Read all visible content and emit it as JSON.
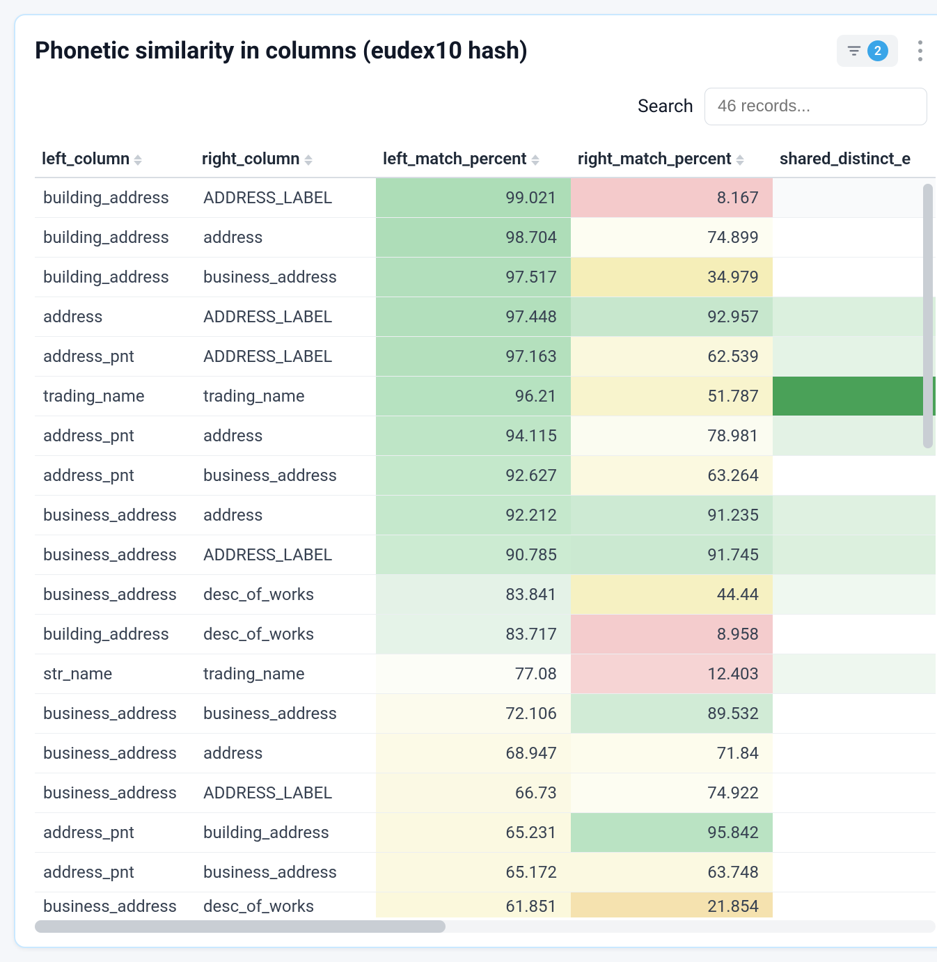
{
  "header": {
    "title": "Phonetic similarity in columns (eudex10 hash)",
    "filter_badge": "2"
  },
  "search": {
    "label": "Search",
    "placeholder": "46 records..."
  },
  "columns": {
    "left_column": "left_column",
    "right_column": "right_column",
    "left_match_percent": "left_match_percent",
    "right_match_percent": "right_match_percent",
    "shared_distinct": "shared_distinct_e"
  },
  "chart_data": {
    "type": "table",
    "title": "Phonetic similarity in columns (eudex10 hash)",
    "columns": [
      "left_column",
      "right_column",
      "left_match_percent",
      "right_match_percent"
    ],
    "rows": [
      {
        "left_column": "building_address",
        "right_column": "ADDRESS_LABEL",
        "left_match_percent": 99.021,
        "right_match_percent": 8.167,
        "lmp_color": "#adddb7",
        "rmp_color": "#f4cacb",
        "sd_color": "#f9fafb"
      },
      {
        "left_column": "building_address",
        "right_column": "address",
        "left_match_percent": 98.704,
        "right_match_percent": 74.899,
        "lmp_color": "#aeddb8",
        "rmp_color": "#fdfdf2",
        "sd_color": "#ffffff"
      },
      {
        "left_column": "building_address",
        "right_column": "business_address",
        "left_match_percent": 97.517,
        "right_match_percent": 34.979,
        "lmp_color": "#b2dfbc",
        "rmp_color": "#f5eeb8",
        "sd_color": "#ffffff"
      },
      {
        "left_column": "address",
        "right_column": "ADDRESS_LABEL",
        "left_match_percent": 97.448,
        "right_match_percent": 92.957,
        "lmp_color": "#b2dfbc",
        "rmp_color": "#c7e7cd",
        "sd_color": "#dbf0de"
      },
      {
        "left_column": "address_pnt",
        "right_column": "ADDRESS_LABEL",
        "left_match_percent": 97.163,
        "right_match_percent": 62.539,
        "lmp_color": "#b4e0bd",
        "rmp_color": "#faf8dd",
        "sd_color": "#e4f3e6"
      },
      {
        "left_column": "trading_name",
        "right_column": "trading_name",
        "left_match_percent": 96.21,
        "right_match_percent": 51.787,
        "lmp_color": "#b6e2c0",
        "rmp_color": "#f8f4cd",
        "sd_color": "#4aa158"
      },
      {
        "left_column": "address_pnt",
        "right_column": "address",
        "left_match_percent": 94.115,
        "right_match_percent": 78.981,
        "lmp_color": "#bee5c6",
        "rmp_color": "#fbfcf1",
        "sd_color": "#e3f2e5"
      },
      {
        "left_column": "address_pnt",
        "right_column": "business_address",
        "left_match_percent": 92.627,
        "right_match_percent": 63.264,
        "lmp_color": "#c4e8cb",
        "rmp_color": "#fbf9e0",
        "sd_color": "#ffffff"
      },
      {
        "left_column": "business_address",
        "right_column": "address",
        "left_match_percent": 92.212,
        "right_match_percent": 91.235,
        "lmp_color": "#c5e8cc",
        "rmp_color": "#cdead3",
        "sd_color": "#dff1e1"
      },
      {
        "left_column": "business_address",
        "right_column": "ADDRESS_LABEL",
        "left_match_percent": 90.785,
        "right_match_percent": 91.745,
        "lmp_color": "#ccebd2",
        "rmp_color": "#cbe9d1",
        "sd_color": "#dcf0de"
      },
      {
        "left_column": "business_address",
        "right_column": "desc_of_works",
        "left_match_percent": 83.841,
        "right_match_percent": 44.44,
        "lmp_color": "#e4f2e7",
        "rmp_color": "#f6f1c2",
        "sd_color": "#eff8f0"
      },
      {
        "left_column": "building_address",
        "right_column": "desc_of_works",
        "left_match_percent": 83.717,
        "right_match_percent": 8.958,
        "lmp_color": "#e5f3e8",
        "rmp_color": "#f4cccd",
        "sd_color": "#ffffff"
      },
      {
        "left_column": "str_name",
        "right_column": "trading_name",
        "left_match_percent": 77.08,
        "right_match_percent": 12.403,
        "lmp_color": "#fcfdf7",
        "rmp_color": "#f6d4d4",
        "sd_color": "#eef7ef"
      },
      {
        "left_column": "business_address",
        "right_column": "business_address",
        "left_match_percent": 72.106,
        "right_match_percent": 89.532,
        "lmp_color": "#fcfbed",
        "rmp_color": "#d1ebd6",
        "sd_color": "#ffffff"
      },
      {
        "left_column": "business_address",
        "right_column": "address",
        "left_match_percent": 68.947,
        "right_match_percent": 71.84,
        "lmp_color": "#fcfae7",
        "rmp_color": "#fdfced",
        "sd_color": "#ffffff"
      },
      {
        "left_column": "business_address",
        "right_column": "ADDRESS_LABEL",
        "left_match_percent": 66.73,
        "right_match_percent": 74.922,
        "lmp_color": "#fbf9e4",
        "rmp_color": "#fdfdf2",
        "sd_color": "#ffffff"
      },
      {
        "left_column": "address_pnt",
        "right_column": "building_address",
        "left_match_percent": 65.231,
        "right_match_percent": 95.842,
        "lmp_color": "#fbf9e1",
        "rmp_color": "#bae3c3",
        "sd_color": "#ffffff"
      },
      {
        "left_column": "address_pnt",
        "right_column": "business_address",
        "left_match_percent": 65.172,
        "right_match_percent": 63.748,
        "lmp_color": "#fbf9e1",
        "rmp_color": "#fbf9e1",
        "sd_color": "#ffffff"
      },
      {
        "left_column": "business_address",
        "right_column": "desc_of_works",
        "left_match_percent": 61.851,
        "right_match_percent": 21.854,
        "lmp_color": "#fbf8dc",
        "rmp_color": "#f5e2af",
        "sd_color": "#ffffff"
      }
    ]
  }
}
